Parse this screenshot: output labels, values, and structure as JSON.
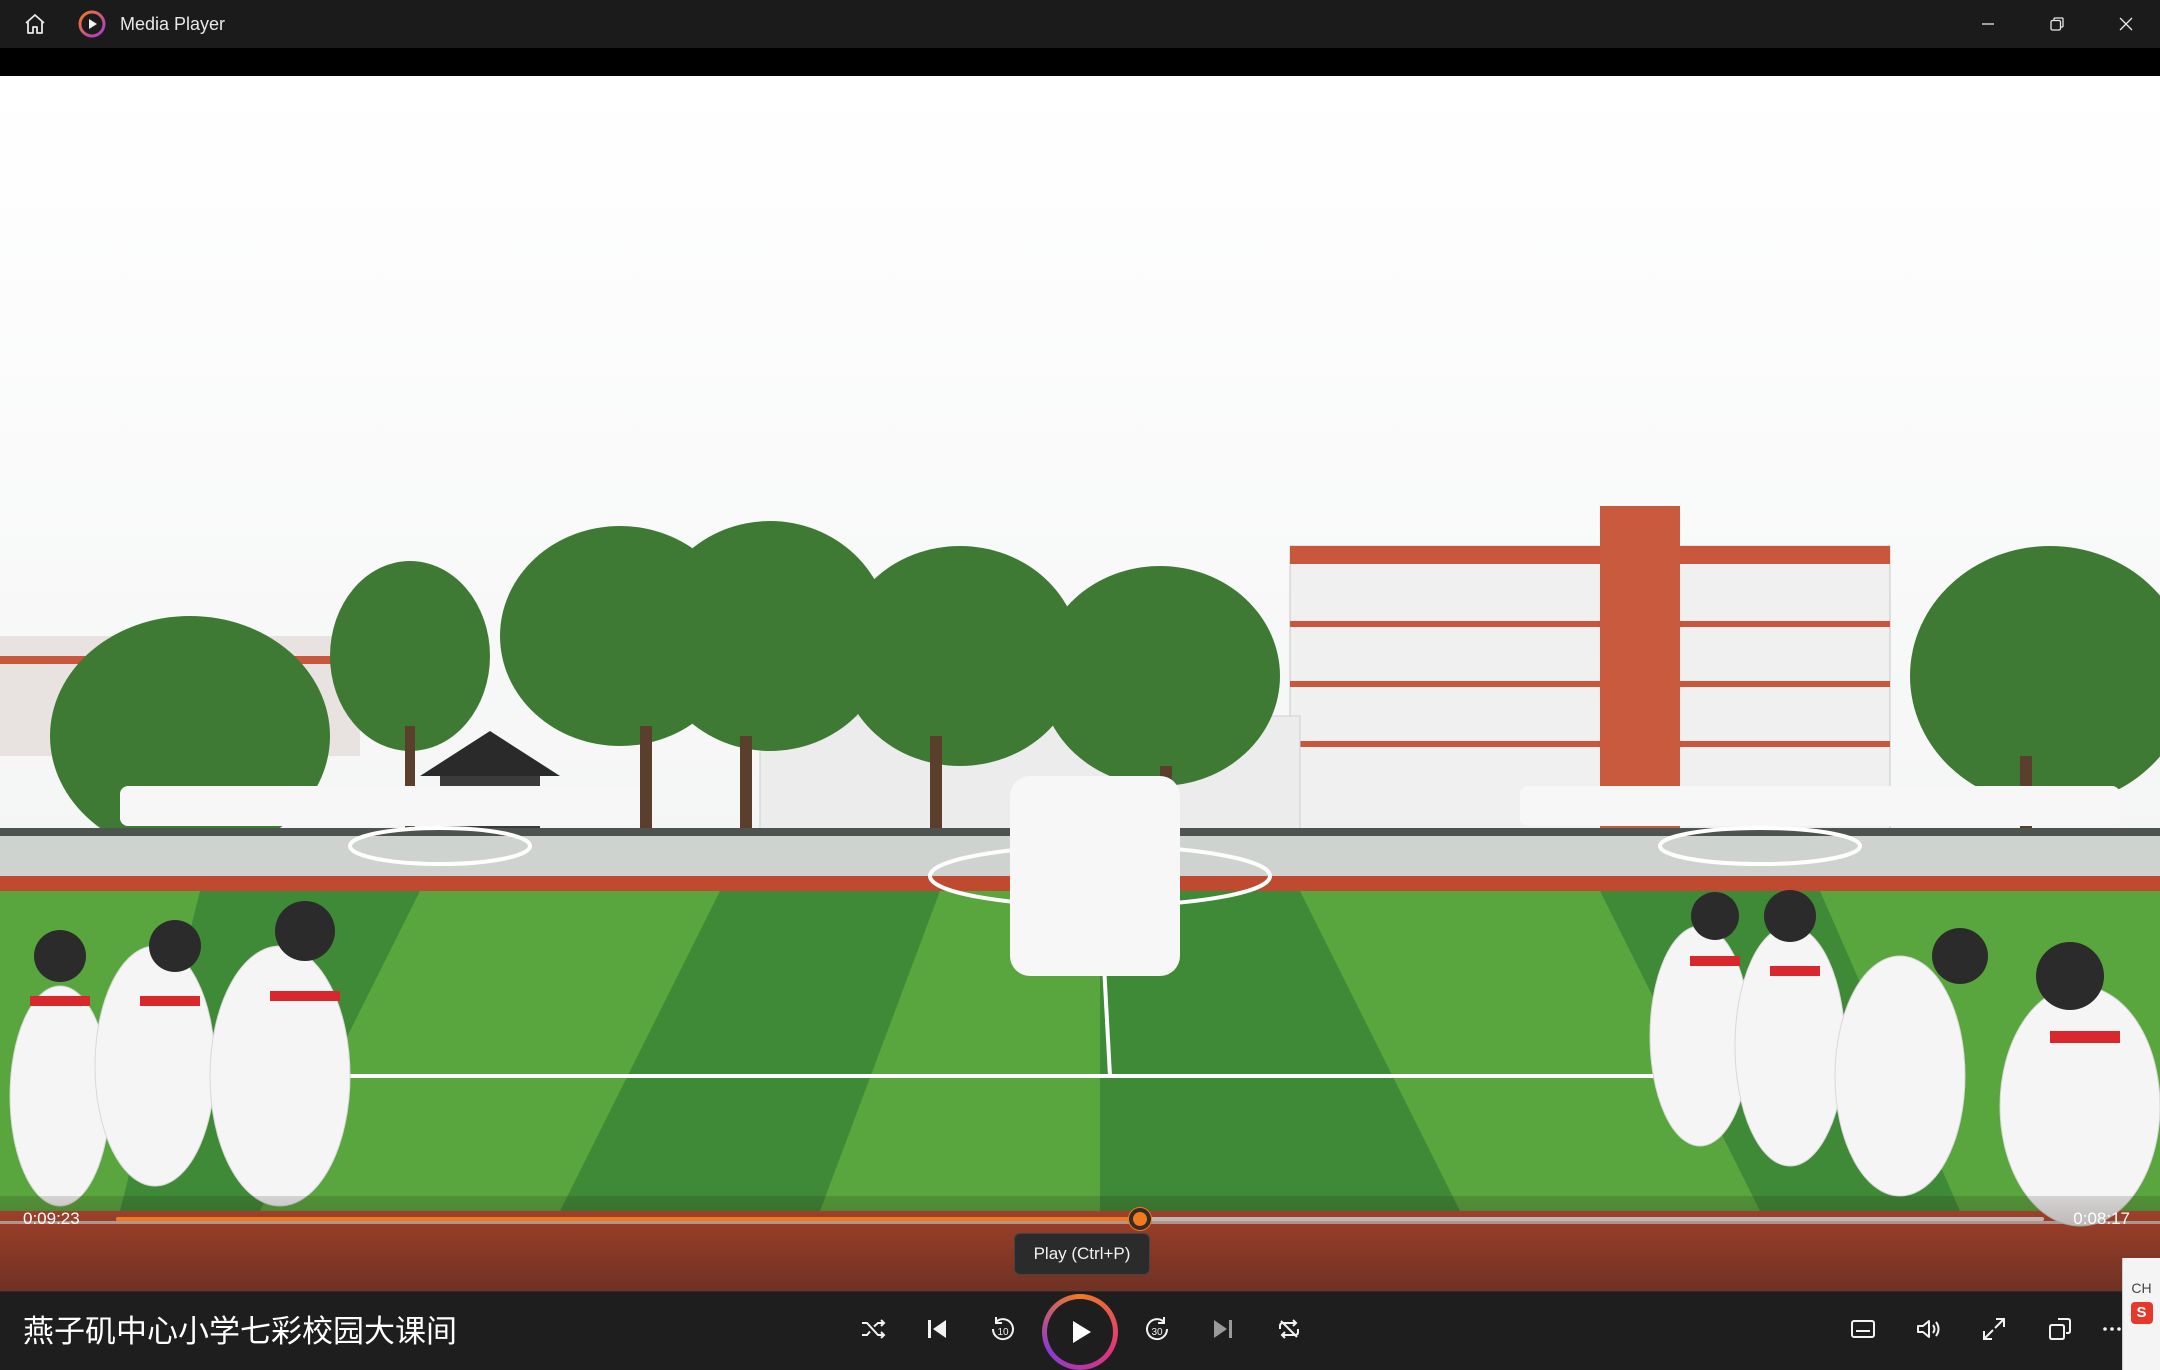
{
  "window": {
    "title": "Media Player",
    "controls": [
      "minimize",
      "restore",
      "close"
    ]
  },
  "playback": {
    "elapsed": "0:09:23",
    "remaining": "0:08:17",
    "progress_fraction": 0.531,
    "state": "paused"
  },
  "tooltip": {
    "text": "Play (Ctrl+P)"
  },
  "media": {
    "title": "燕子矶中心小学七彩校园大课间"
  },
  "controls": {
    "left": [
      "shuffle-icon",
      "previous-icon",
      "rewind-10-icon",
      "play-icon",
      "forward-30-icon",
      "next-icon",
      "repeat-icon"
    ],
    "right": [
      "captions-icon",
      "volume-icon",
      "fullscreen-icon",
      "mini-player-icon",
      "more-icon"
    ]
  },
  "ime": {
    "label": "CH",
    "logo": "S"
  },
  "colors": {
    "accent": "#f07a22",
    "titlebar": "#1b1b1b",
    "bottombar": "#1e1e1e"
  }
}
